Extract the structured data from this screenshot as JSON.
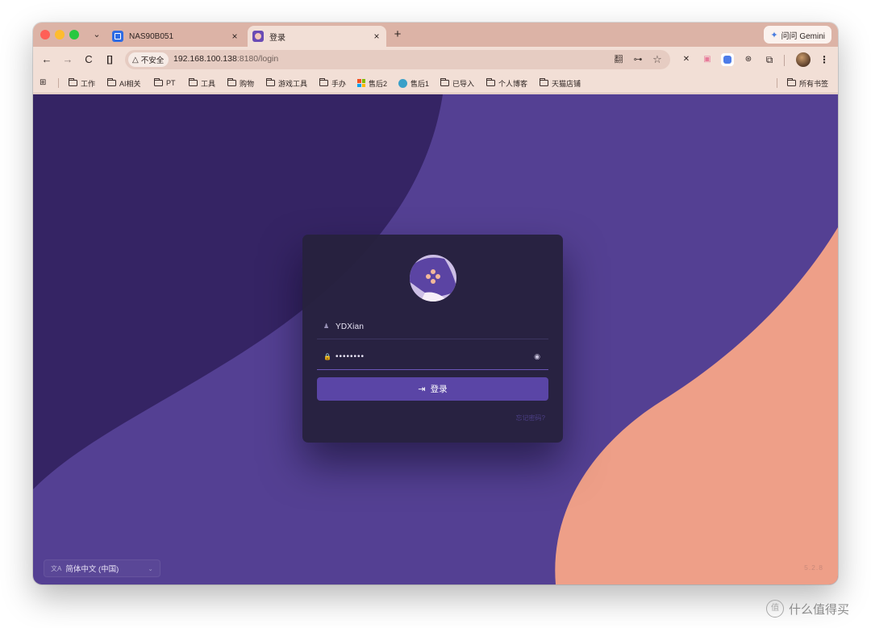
{
  "browser": {
    "tabs": [
      {
        "title": "NAS90B051",
        "close": "×"
      },
      {
        "title": "登录",
        "close": "×"
      }
    ],
    "new_tab": "+",
    "gemini_label": "问问 Gemini",
    "security_label": "不安全",
    "url_host": "192.168.100.138",
    "url_path": ":8180/login",
    "icons": {
      "back": "←",
      "forward": "→",
      "reload": "C",
      "split": "[]",
      "warning": "△",
      "translate": "翻",
      "key": "⊶",
      "star": "☆",
      "menu": "⋮",
      "tab_menu": "⌄",
      "apps": "⊞"
    }
  },
  "bookmarks": {
    "items": [
      "工作",
      "AI相关",
      "PT",
      "工具",
      "购物",
      "游戏工具",
      "手办",
      "售后2",
      "售后1",
      "已导入",
      "个人博客",
      "天猫店铺"
    ],
    "all_bookmarks": "所有书签"
  },
  "login": {
    "username": "YDXian",
    "password_mask": "••••••••",
    "button_label": "登录",
    "button_icon": "⇥",
    "forgot_password": "忘记密码?",
    "user_icon": "♟",
    "lock_icon": "🔒",
    "eye_icon": "◉"
  },
  "footer": {
    "language": "简体中文 (中国)",
    "lang_icon": "文A",
    "lang_caret": "⌄",
    "version": "5.2.8"
  },
  "colors": {
    "page_purple": "#544093",
    "dark_purple": "#352464",
    "peach": "#ee9f88",
    "card": "#26213d",
    "button": "#5a45a6",
    "tab_strip": "#dcb3a6",
    "toolbar": "#f2dfd6"
  },
  "watermark": {
    "text": "什么值得买",
    "icon": "值"
  }
}
